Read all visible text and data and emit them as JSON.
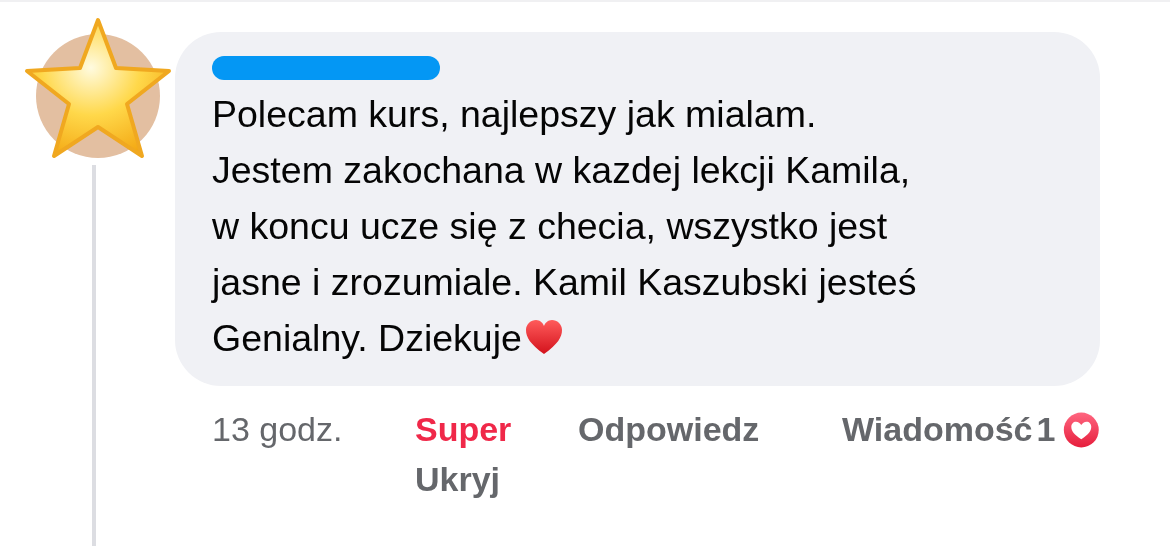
{
  "comment": {
    "lines": [
      "Polecam kurs, najlepszy jak mialam.",
      "Jestem zakochana w kazdej lekcji Kamila,",
      "w koncu ucze się z checia, wszystko jest",
      "jasne i zrozumiale. Kamil Kaszubski jesteś",
      "Genialny. Dziekuje"
    ]
  },
  "actions": {
    "time": "13 godz.",
    "like": {
      "label": "Super",
      "reacted": true
    },
    "hide": "Ukryj",
    "reply": "Odpowiedz",
    "message": "Wiadomość",
    "reaction_count": "1"
  }
}
